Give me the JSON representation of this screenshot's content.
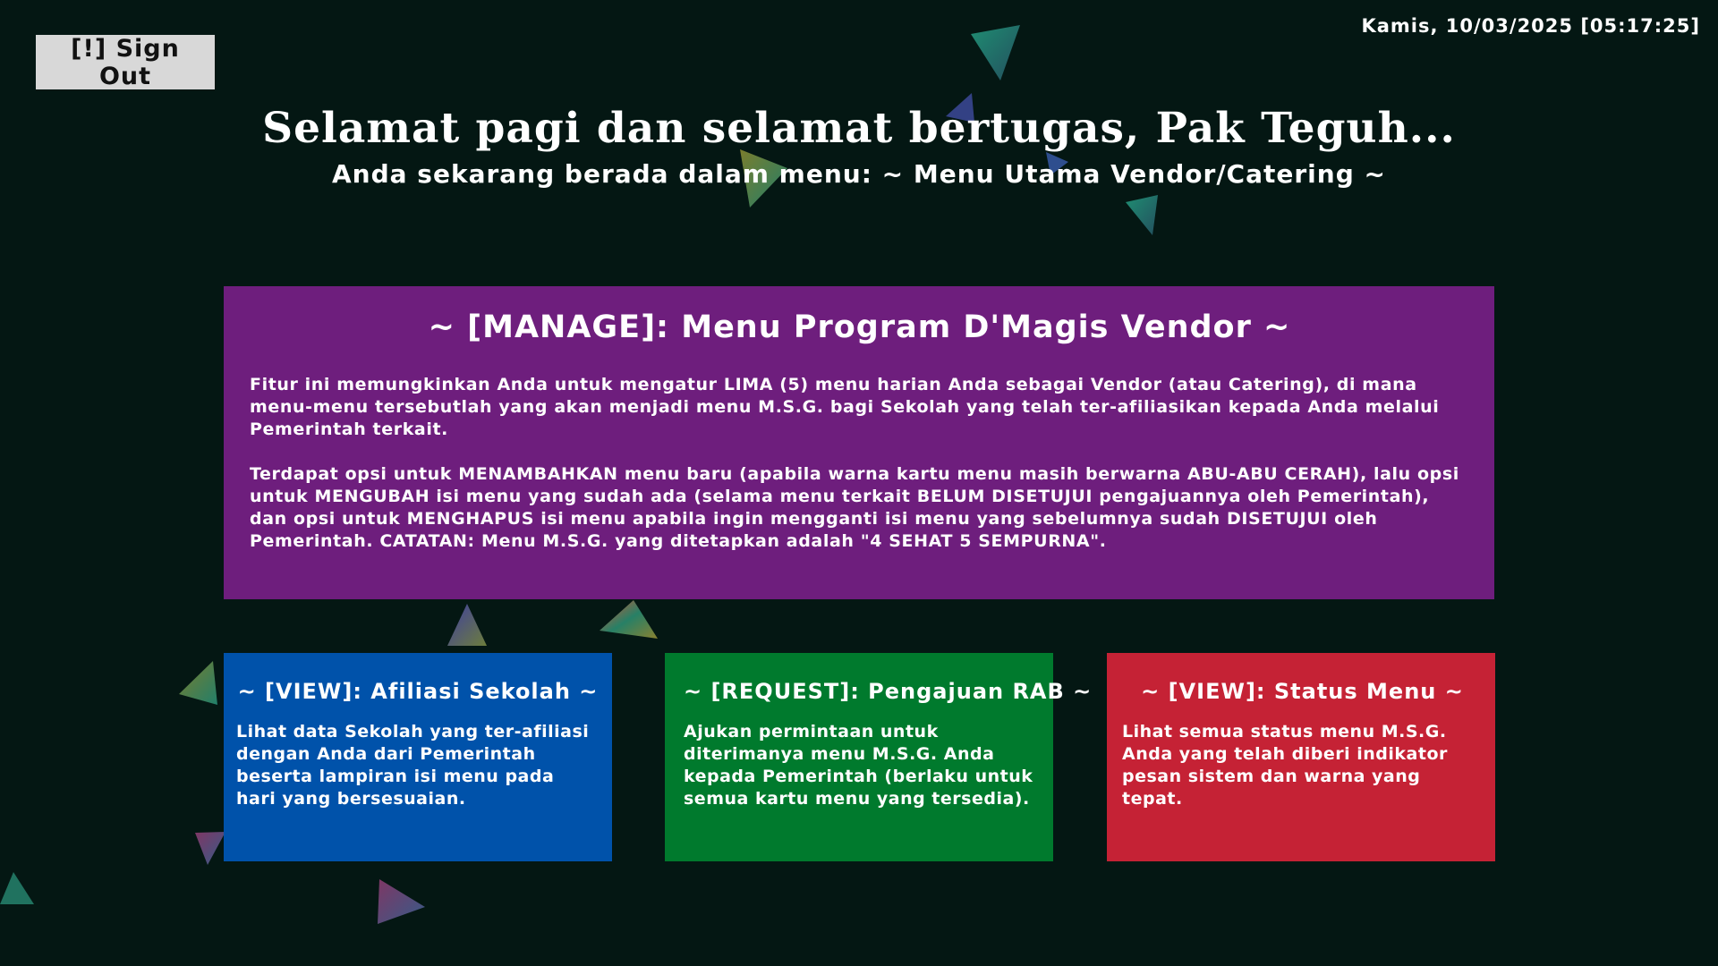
{
  "header": {
    "sign_out_label": "[!] Sign Out",
    "datetime": "Kamis, 10/03/2025 [05:17:25]",
    "greeting": "Selamat pagi dan selamat bertugas, Pak Teguh...",
    "menu_status": "Anda sekarang berada dalam menu: ~ Menu Utama Vendor/Catering ~"
  },
  "manage_card": {
    "title": "~ [MANAGE]: Menu Program D'Magis Vendor ~",
    "paragraph_1": "Fitur ini memungkinkan Anda untuk mengatur LIMA (5) menu harian Anda sebagai Vendor (atau Catering), di mana menu-menu tersebutlah yang akan menjadi menu M.S.G. bagi Sekolah yang telah ter-afiliasikan kepada Anda melalui Pemerintah terkait.",
    "paragraph_2": "Terdapat opsi untuk MENAMBAHKAN menu baru (apabila warna kartu menu masih berwarna ABU-ABU CERAH), lalu opsi untuk MENGUBAH isi menu yang sudah ada (selama menu terkait BELUM DISETUJUI pengajuannya oleh Pemerintah), dan opsi untuk MENGHAPUS isi menu apabila ingin mengganti isi menu yang sebelumnya sudah DISETUJUI oleh Pemerintah. CATATAN: Menu M.S.G. yang ditetapkan adalah \"4 SEHAT 5 SEMPURNA\".",
    "color": "#6e1e7d"
  },
  "cards": [
    {
      "title": "~ [VIEW]: Afiliasi Sekolah ~",
      "text": "Lihat data Sekolah yang ter-afiliasi dengan Anda dari Pemerintah beserta lampiran isi menu pada hari yang bersesuaian.",
      "color": "#0052aa"
    },
    {
      "title": "~ [REQUEST]: Pengajuan RAB ~",
      "text": "Ajukan permintaan untuk diterimanya menu M.S.G. Anda kepada Pemerintah (berlaku untuk semua kartu menu yang tersedia).",
      "color": "#007a2d"
    },
    {
      "title": "~ [VIEW]: Status Menu ~",
      "text": "Lihat semua status menu M.S.G. Anda yang telah diberi indikator pesan sistem dan warna yang tepat.",
      "color": "#c52235"
    }
  ],
  "colors": {
    "background": "#041713",
    "sign_out_button": "#d8d8d8"
  },
  "icons": [
    "floating-triangle-decoration"
  ]
}
